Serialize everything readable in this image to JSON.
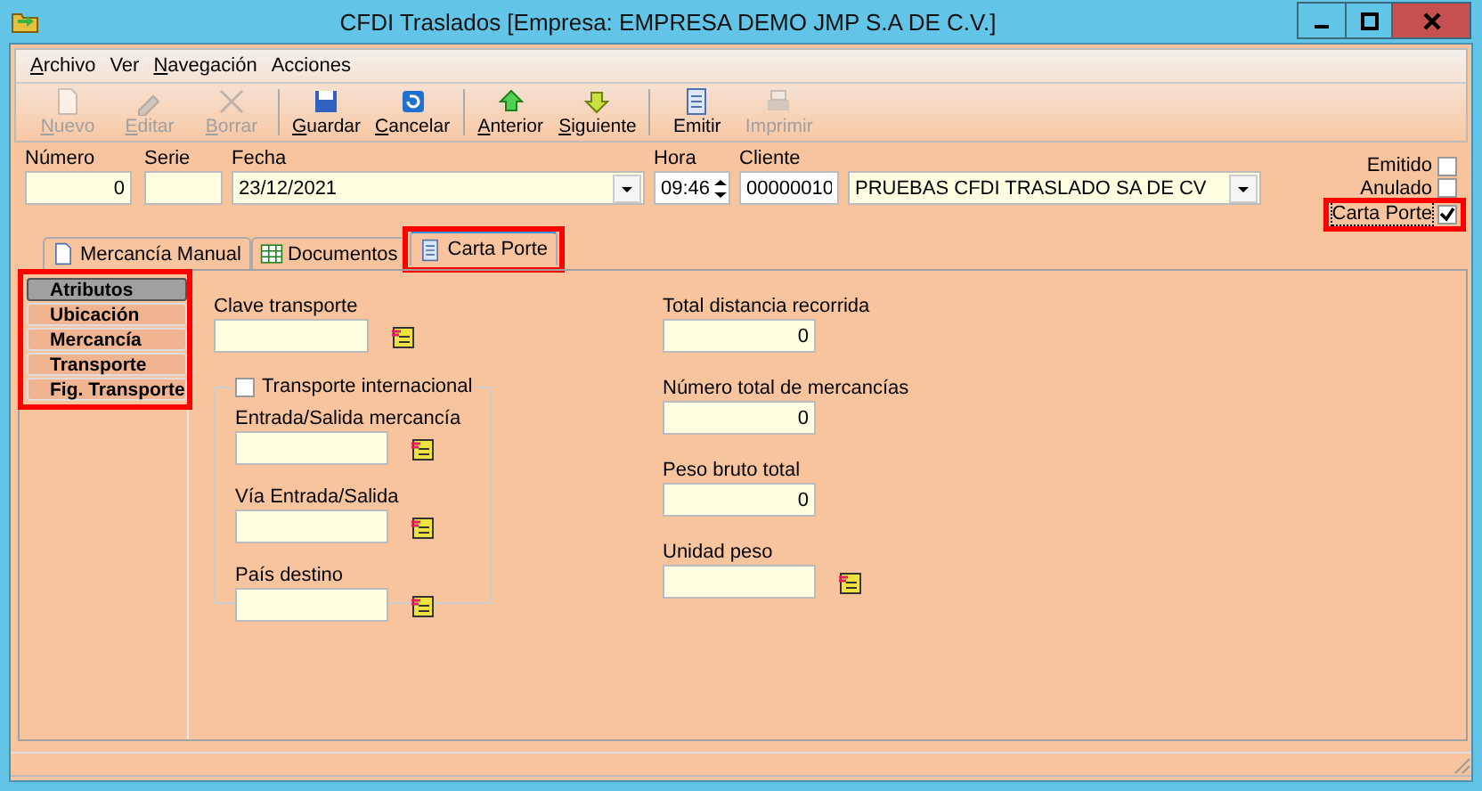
{
  "window": {
    "title": "CFDI Traslados [Empresa: EMPRESA DEMO JMP S.A DE C.V.]"
  },
  "menu": [
    {
      "label": "Archivo",
      "accel": true
    },
    {
      "label": "Ver",
      "accel": false
    },
    {
      "label": "Navegación",
      "accel": true
    },
    {
      "label": "Acciones",
      "accel": false
    }
  ],
  "toolbar": [
    [
      {
        "label": "Nuevo",
        "kind": "page",
        "accel": true,
        "disabled": true
      },
      {
        "label": "Editar",
        "kind": "pen",
        "accel": true,
        "disabled": true
      },
      {
        "label": "Borrar",
        "kind": "cross",
        "accel": true,
        "disabled": true
      }
    ],
    [
      {
        "label": "Guardar",
        "kind": "floppy",
        "accel": true,
        "disabled": false
      },
      {
        "label": "Cancelar",
        "kind": "undo",
        "accel": true,
        "disabled": false
      }
    ],
    [
      {
        "label": "Anterior",
        "kind": "up",
        "accel": true,
        "disabled": false
      },
      {
        "label": "Siguiente",
        "kind": "down",
        "accel": true,
        "disabled": false
      }
    ],
    [
      {
        "label": "Emitir",
        "kind": "doc",
        "accel": false,
        "disabled": false
      },
      {
        "label": "Imprimir",
        "kind": "printer",
        "accel": false,
        "disabled": true
      }
    ]
  ],
  "header": [
    {
      "label": "Número",
      "value": "0",
      "kind": "number"
    },
    {
      "label": "Serie",
      "kind": "text"
    },
    {
      "label": "Fecha",
      "value": "23/12/2021",
      "kind": "date"
    },
    {
      "label": "Hora",
      "value": "09:46",
      "kind": "spin"
    },
    {
      "label": "Cliente",
      "value": "00000010",
      "kind": "code"
    },
    {
      "value": "PRUEBAS CFDI TRASLADO SA DE CV",
      "kind": "combo"
    }
  ],
  "flags": [
    {
      "label": "Emitido",
      "checked": false,
      "highlighted": false
    },
    {
      "label": "Anulado",
      "checked": false,
      "highlighted": false
    },
    {
      "label": "Carta Porte",
      "checked": true,
      "highlighted": true
    }
  ],
  "tabs": [
    {
      "label": "Mercancía Manual",
      "kind": "page",
      "selected": false,
      "highlighted": false
    },
    {
      "label": "Documentos",
      "kind": "grid",
      "selected": false,
      "highlighted": false
    },
    {
      "label": "Carta Porte",
      "kind": "doc",
      "selected": true,
      "highlighted": true
    }
  ],
  "side_nav": {
    "highlighted": true,
    "items": [
      {
        "label": "Atributos",
        "selected": true
      },
      {
        "label": "Ubicación",
        "selected": false
      },
      {
        "label": "Mercancía",
        "selected": false
      },
      {
        "label": "Transporte",
        "selected": false
      },
      {
        "label": "Fig. Transporte",
        "selected": false
      }
    ]
  },
  "clave_transporte": {
    "label": "Clave transporte"
  },
  "international": {
    "label": "Transporte internacional",
    "checked": false,
    "fields": [
      {
        "label": "Entrada/Salida mercancía"
      },
      {
        "label": "Vía Entrada/Salida"
      },
      {
        "label": "País destino"
      }
    ]
  },
  "totals": [
    {
      "label": "Total distancia recorrida",
      "value": "0",
      "lookup": false
    },
    {
      "label": "Número total de mercancías",
      "value": "0",
      "lookup": false
    },
    {
      "label": "Peso bruto total",
      "value": "0",
      "lookup": false
    },
    {
      "label": "Unidad peso",
      "lookup": true
    }
  ]
}
